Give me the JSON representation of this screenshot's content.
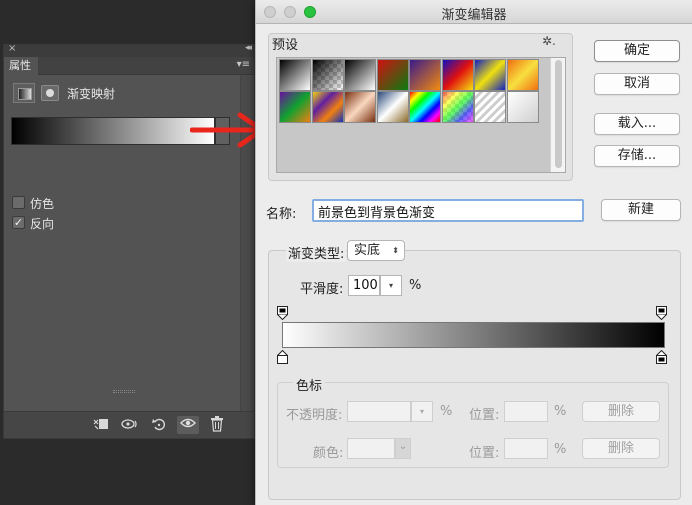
{
  "properties_panel": {
    "close_glyph": "×",
    "collapse_glyph": "◂◂",
    "tab_label": "属性",
    "menu_glyph": "▾≡",
    "adjustment_title": "渐变映射",
    "gradient_dropdown_glyph": "▾",
    "dither": {
      "label": "仿色",
      "checked": false
    },
    "reverse": {
      "label": "反向",
      "checked": true,
      "check_glyph": "✓"
    },
    "footer_icons": [
      "clip-to-layer-icon",
      "view-previous-state-icon",
      "reset-icon",
      "toggle-visibility-icon",
      "delete-icon"
    ]
  },
  "dialog": {
    "title": "渐变编辑器",
    "presets": {
      "label": "预设",
      "gear_glyph": "✲.",
      "swatches": [
        {
          "name": "foreground-to-background",
          "gradient": "linear-gradient(135deg,#000 0%,#fff 100%)"
        },
        {
          "name": "foreground-to-transparent",
          "gradient": "linear-gradient(135deg,#000 0%,rgba(0,0,0,0) 100%)"
        },
        {
          "name": "black-white",
          "gradient": "linear-gradient(135deg,#000 0%,#fff 100%)"
        },
        {
          "name": "red-green",
          "gradient": "linear-gradient(135deg,#d01010 0%,#0a7d10 100%)"
        },
        {
          "name": "violet-orange",
          "gradient": "linear-gradient(135deg,#3a1a8a 0%,#f28a10 100%)"
        },
        {
          "name": "blue-red-yellow",
          "gradient": "linear-gradient(135deg,#1010c0 0%,#e01010 50%,#f5e010 100%)"
        },
        {
          "name": "blue-yellow-blue",
          "gradient": "linear-gradient(135deg,#1020c0 0%,#f0e010 50%,#1020c0 100%)"
        },
        {
          "name": "orange-yellow-orange",
          "gradient": "linear-gradient(135deg,#f07010 0%,#f8e040 50%,#f07010 100%)"
        },
        {
          "name": "violet-green-orange",
          "gradient": "linear-gradient(135deg,#6a10a0 0%,#10a030 50%,#f08010 100%)"
        },
        {
          "name": "yellow-violet-orange-blue",
          "gradient": "linear-gradient(135deg,#f0d010 0%,#6020a0 35%,#f08010 65%,#1030c0 100%)"
        },
        {
          "name": "copper",
          "gradient": "linear-gradient(135deg,#7a3010 0%,#f8d8c0 50%,#7a3010 100%)"
        },
        {
          "name": "chrome",
          "gradient": "linear-gradient(135deg,#2a4a7a 0%,#ffffff 50%,#8a6a2a 100%)"
        },
        {
          "name": "spectrum",
          "gradient": "linear-gradient(135deg,#f00 0%,#ff0 17%,#0f0 33%,#0ff 50%,#00f 67%,#f0f 83%,#f00 100%)"
        },
        {
          "name": "transparent-rainbow",
          "gradient": "linear-gradient(135deg,rgba(255,0,0,0.6) 0%,rgba(255,255,0,0.6) 25%,rgba(0,255,0,0.6) 50%,rgba(0,0,255,0.6) 75%,rgba(255,0,255,0.6) 100%)"
        },
        {
          "name": "transparent-stripes",
          "gradient": "repeating-linear-gradient(135deg,#fff 0px,#fff 3px,#ccc 3px,#ccc 6px)"
        },
        {
          "name": "neutral-density",
          "gradient": "linear-gradient(135deg,#ffffff 0%,#d0d0d0 100%)"
        }
      ]
    },
    "buttons": {
      "ok": "确定",
      "cancel": "取消",
      "load": "载入...",
      "save": "存储...",
      "new": "新建"
    },
    "name": {
      "label": "名称:",
      "value": "前景色到背景色渐变"
    },
    "gradient_type": {
      "label": "渐变类型:",
      "value": "实底",
      "arrow": "⬍"
    },
    "smoothness": {
      "label": "平滑度:",
      "value": "100",
      "arrow": "▾",
      "unit": "%"
    },
    "stops": {
      "group_label": "色标",
      "opacity_label": "不透明度:",
      "opacity_unit": "%",
      "opacity_arrow": "▾",
      "location_label_1": "位置:",
      "location_unit_1": "%",
      "delete_label_1": "删除",
      "color_label": "颜色:",
      "color_arrow": "⌄",
      "location_label_2": "位置:",
      "location_unit_2": "%",
      "delete_label_2": "删除"
    },
    "gradient": {
      "start_color": "#ffffff",
      "end_color": "#000000"
    }
  },
  "colors": {
    "accent_focus": "#83aee2",
    "maximize_green": "#2ac33f",
    "annotation_arrow": "#e8261c"
  }
}
